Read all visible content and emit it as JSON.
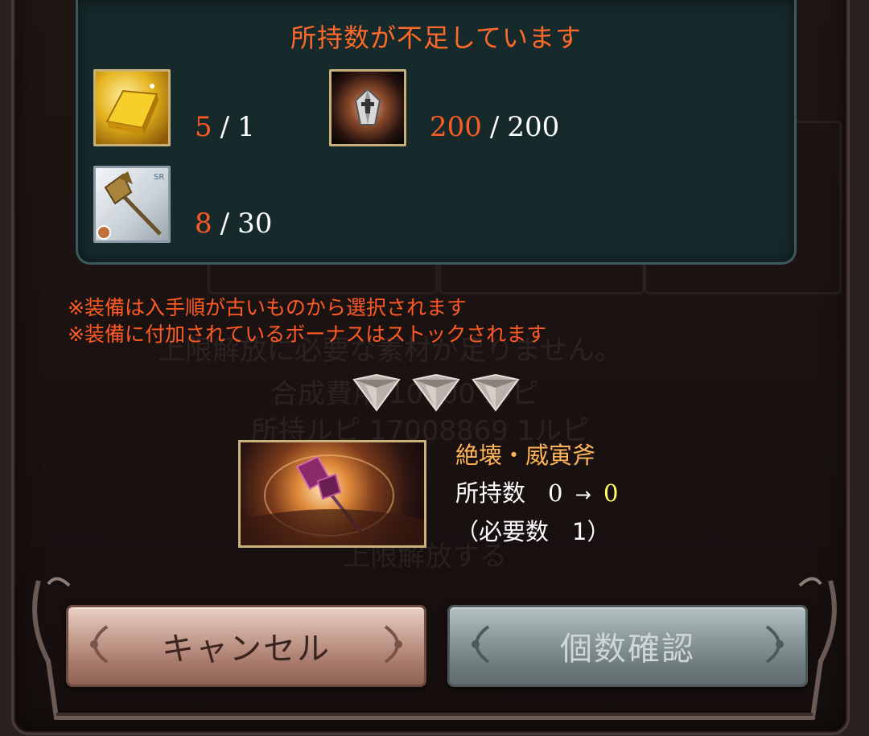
{
  "requirement": {
    "title": "所持数が不足しています",
    "materials": [
      {
        "icon": "gold-bar-icon",
        "have": "5",
        "need": "1"
      },
      {
        "icon": "dark-crystal-icon",
        "have": "200",
        "need": "200"
      },
      {
        "icon": "axe-weapon-icon",
        "have": "8",
        "need": "30"
      }
    ],
    "separator": "/"
  },
  "notes": [
    "※装備は入手順が古いものから選択されます",
    "※装備に付加されているボーナスはストックされます"
  ],
  "background_ghost": {
    "line1": "上限解放に必要な素材が足りません。",
    "cost": "合成費用 10000 ルピ",
    "owned_rupie": "所持ルピ 17008869 1ルピ",
    "button": "上限解放する"
  },
  "result": {
    "name": "絶壊・威寅斧",
    "hold_label": "所持数",
    "hold_before": "0",
    "arrow": "→",
    "hold_after": "0",
    "need_text": "（必要数　1）"
  },
  "buttons": {
    "cancel": "キャンセル",
    "confirm": "個数確認"
  },
  "colors": {
    "warning": "#ff6a2a",
    "panel": "#16292b",
    "name": "#ffb45a",
    "highlight": "#ffff66"
  }
}
